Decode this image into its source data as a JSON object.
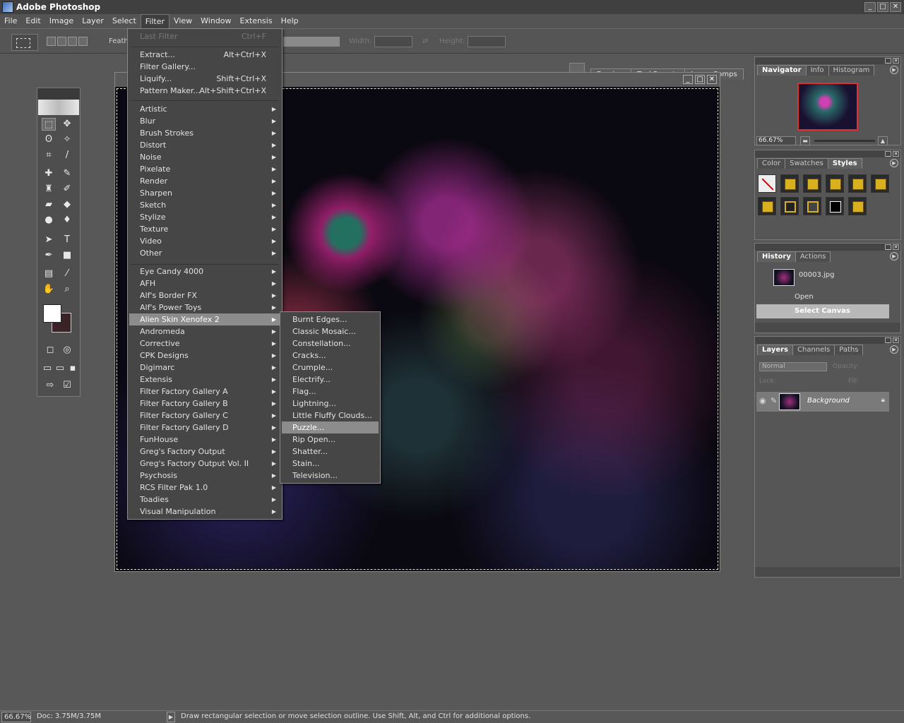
{
  "app": {
    "title": "Adobe Photoshop",
    "window_controls": [
      "_",
      "□",
      "✕"
    ]
  },
  "menubar": [
    "File",
    "Edit",
    "Image",
    "Layer",
    "Select",
    "Filter",
    "View",
    "Window",
    "Extensis",
    "Help"
  ],
  "options_bar": {
    "feather_label": "Feath",
    "width_label": "Width:",
    "height_label": "Height:",
    "well_tabs": [
      "Brushes",
      "Tool Presets",
      "Layer Comps"
    ]
  },
  "filter_menu": {
    "top_items": [
      {
        "label": "Last Filter",
        "shortcut": "Ctrl+F",
        "disabled": true
      },
      {
        "label": "Extract...",
        "shortcut": "Alt+Ctrl+X"
      },
      {
        "label": "Filter Gallery...",
        "shortcut": ""
      },
      {
        "label": "Liquify...",
        "shortcut": "Shift+Ctrl+X"
      },
      {
        "label": "Pattern Maker...",
        "shortcut": "Alt+Shift+Ctrl+X"
      }
    ],
    "builtin": [
      "Artistic",
      "Blur",
      "Brush Strokes",
      "Distort",
      "Noise",
      "Pixelate",
      "Render",
      "Sharpen",
      "Sketch",
      "Stylize",
      "Texture",
      "Video",
      "Other"
    ],
    "plugins": [
      "Eye Candy 4000",
      "AFH",
      "Alf's Border FX",
      "Alf's Power Toys",
      "Alien Skin Xenofex 2",
      "Andromeda",
      "Corrective",
      "CPK Designs",
      "Digimarc",
      "Extensis",
      "Filter Factory Gallery A",
      "Filter Factory Gallery B",
      "Filter Factory Gallery C",
      "Filter Factory Gallery D",
      "FunHouse",
      "Greg's Factory Output",
      "Greg's Factory Output Vol. II",
      "Psychosis",
      "RCS Filter Pak 1.0",
      "Toadies",
      "Visual Manipulation"
    ],
    "highlighted_plugin": "Alien Skin Xenofex 2"
  },
  "submenu": {
    "items": [
      "Burnt Edges...",
      "Classic Mosaic...",
      "Constellation...",
      "Cracks...",
      "Crumple...",
      "Electrify...",
      "Flag...",
      "Lightning...",
      "Little Fluffy Clouds...",
      "Puzzle...",
      "Rip Open...",
      "Shatter...",
      "Stain...",
      "Television..."
    ],
    "highlighted": "Puzzle..."
  },
  "navigator": {
    "tabs": [
      "Navigator",
      "Info",
      "Histogram"
    ],
    "zoom": "66.67%"
  },
  "styles": {
    "tabs": [
      "Color",
      "Swatches",
      "Styles"
    ]
  },
  "history": {
    "tabs": [
      "History",
      "Actions"
    ],
    "snapshot": "00003.jpg",
    "states": [
      "Open",
      "Select Canvas"
    ]
  },
  "layers": {
    "tabs": [
      "Layers",
      "Channels",
      "Paths"
    ],
    "blend_mode": "Normal",
    "opacity_label": "Opacity:",
    "lock_label": "Lock:",
    "fill_label": "Fill:",
    "layer_name": "Background"
  },
  "status": {
    "zoom": "66.67%",
    "doc": "Doc: 3.75M/3.75M",
    "message": "Draw rectangular selection or move selection outline.  Use Shift, Alt, and Ctrl for additional options."
  },
  "colors": {
    "foreground": "#ffffff",
    "background": "#3a2226",
    "menu_highlight": "#8c8c8c"
  }
}
